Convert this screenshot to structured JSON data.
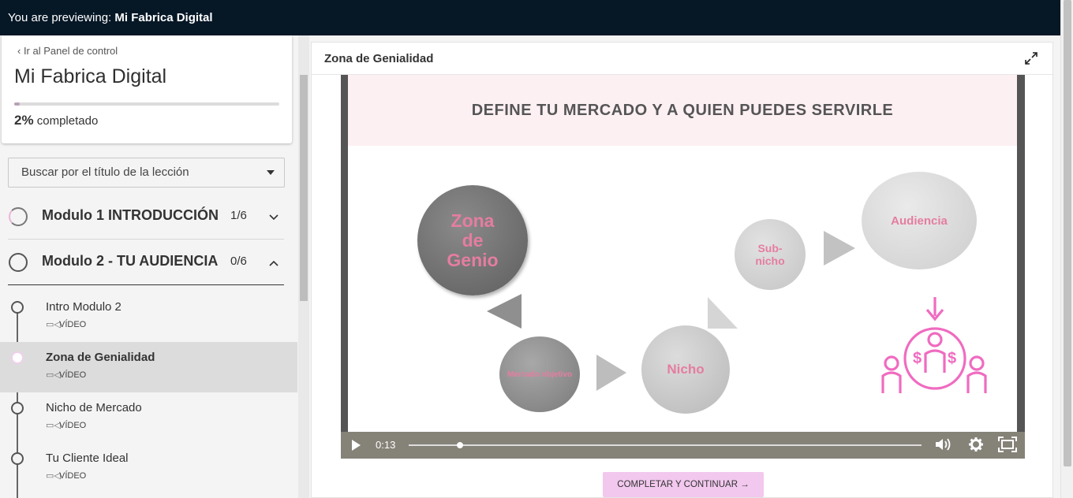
{
  "topbar": {
    "prefix": "You are previewing:",
    "school": "Mi Fabrica Digital"
  },
  "sidebar": {
    "back_link": "‹ Ir al Panel de control",
    "course_title": "Mi Fabrica Digital",
    "progress": {
      "percent_label": "2%",
      "suffix": "completado",
      "fraction": 0.02
    },
    "search_placeholder": "Buscar por el título de la lección",
    "modules": [
      {
        "title": "Modulo 1 INTRODUCCIÓN",
        "count": "1/6",
        "chevron": "chevron-down-icon"
      },
      {
        "title": "Modulo 2 - TU AUDIENCIA",
        "count": "0/6",
        "chevron": "chevron-up-icon"
      }
    ],
    "lessons": [
      {
        "title": "Intro Modulo 2",
        "type": "VÍDEO"
      },
      {
        "title": "Zona de Genialidad",
        "type": "VÍDEO",
        "active": true
      },
      {
        "title": "Nicho de Mercado",
        "type": "VÍDEO"
      },
      {
        "title": "Tu Cliente Ideal",
        "type": "VÍDEO"
      }
    ]
  },
  "main": {
    "lesson_title": "Zona de Genialidad",
    "slide": {
      "title": "DEFINE TU MERCADO Y A QUIEN PUEDES SERVIRLE",
      "bubbles": {
        "genio": "Zona de Genio",
        "mercado": "Mercado objetivo",
        "nicho": "Nicho",
        "subnicho": "Sub-nicho",
        "audiencia": "Audiencia"
      }
    },
    "player": {
      "time": "0:13",
      "progress_fraction": 0.1
    },
    "complete_button": "COMPLETAR Y CONTINUAR →"
  },
  "colors": {
    "topbar": "#061726",
    "accent_pink": "#f2c8ee",
    "slide_pink_text": "#e57da0"
  }
}
